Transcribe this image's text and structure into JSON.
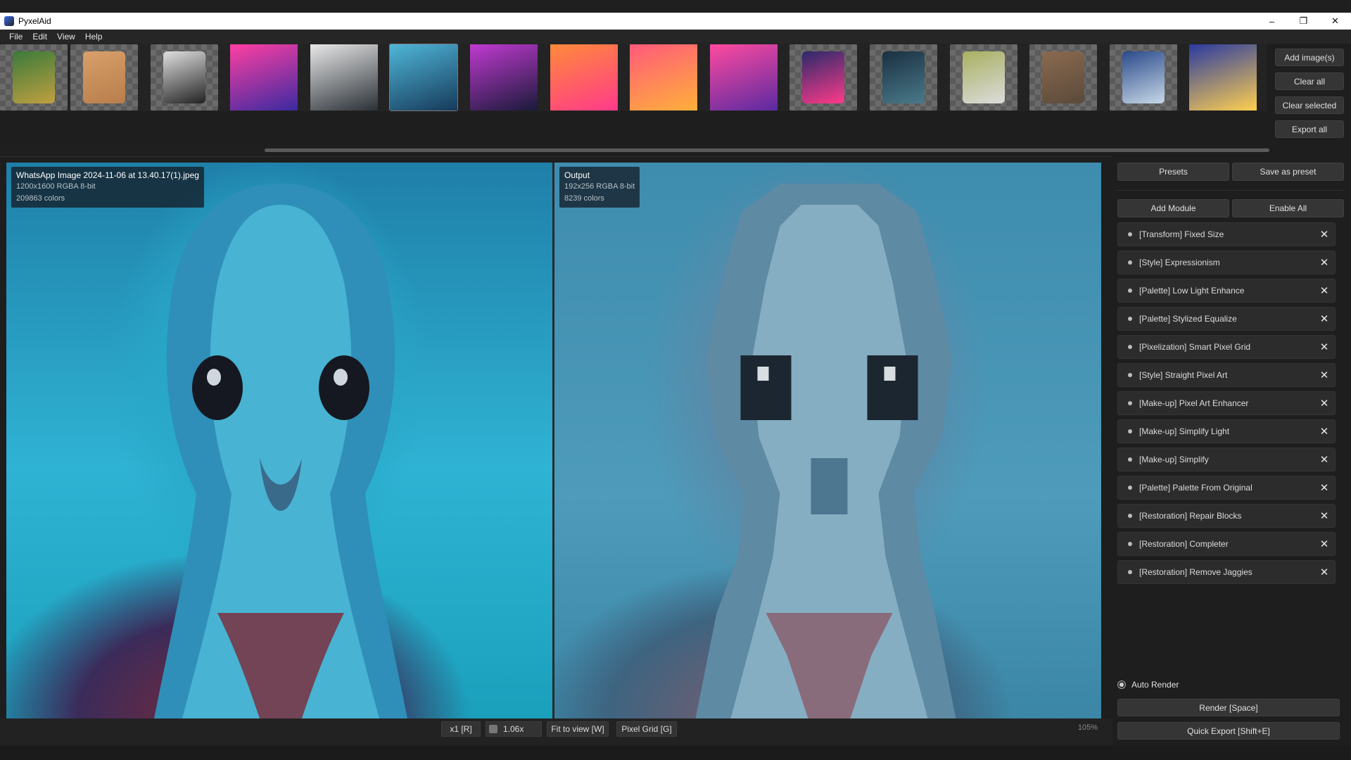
{
  "window": {
    "title": "PyxelAid",
    "minimize": "–",
    "restore": "❐",
    "close": "✕"
  },
  "menu": [
    "File",
    "Edit",
    "View",
    "Help"
  ],
  "thumbnails": [
    {
      "name": "dragon",
      "colors": [
        "#3a7a3a",
        "#c0a040"
      ]
    },
    {
      "name": "kitten",
      "colors": [
        "#d9a06a",
        "#b87d4b"
      ]
    },
    {
      "name": "figurine",
      "colors": [
        "#e0e0e0",
        "#222222"
      ]
    },
    {
      "name": "neon-woman-arcade",
      "colors": [
        "#ff3fa3",
        "#3a2aa0"
      ]
    },
    {
      "name": "scientist",
      "colors": [
        "#e8e8e8",
        "#2a3036"
      ]
    },
    {
      "name": "alien",
      "colors": [
        "#4fb6d8",
        "#163a5a"
      ]
    },
    {
      "name": "neon-woman-jacket",
      "colors": [
        "#c03ad0",
        "#1a1a3a"
      ]
    },
    {
      "name": "retro-beach-woman",
      "colors": [
        "#ff8a3a",
        "#ff3a8a"
      ]
    },
    {
      "name": "neon-street-woman",
      "colors": [
        "#ff5a7a",
        "#ffb03a"
      ]
    },
    {
      "name": "pink-hair-woman",
      "colors": [
        "#ff4aa0",
        "#5a2aa0"
      ]
    },
    {
      "name": "neon-car",
      "colors": [
        "#2a2a6a",
        "#ff3a8a"
      ]
    },
    {
      "name": "torii-landscape",
      "colors": [
        "#1a3040",
        "#4a7a8a"
      ]
    },
    {
      "name": "retro-computers",
      "colors": [
        "#a8b060",
        "#dcdcdc"
      ]
    },
    {
      "name": "zombie-figure",
      "colors": [
        "#8a6a50",
        "#5a4a3a"
      ]
    },
    {
      "name": "blue-car",
      "colors": [
        "#2a4a8a",
        "#c8d8e8"
      ]
    },
    {
      "name": "dancer-poster",
      "colors": [
        "#2a3aa0",
        "#ffd050"
      ]
    }
  ],
  "side_buttons": {
    "add_images": "Add image(s)",
    "clear_all": "Clear all",
    "clear_selected": "Clear selected",
    "export_all": "Export all"
  },
  "input_info": {
    "filename": "WhatsApp Image 2024-11-06 at 13.40.17(1).jpeg",
    "dims": "1200x1600  RGBA  8-bit",
    "colors": "209863 colors"
  },
  "output_info": {
    "title": "Output",
    "dims": "192x256  RGBA  8-bit",
    "colors": "8239 colors"
  },
  "statusbar": {
    "scale": "x1 [R]",
    "zoom_value": "1.06x",
    "fit": "Fit to view [W]",
    "pixel_grid": "Pixel Grid [G]",
    "zoom_percent": "105%"
  },
  "panel": {
    "presets": "Presets",
    "save_preset": "Save as preset",
    "add_module": "Add Module",
    "enable_all": "Enable All",
    "modules": [
      "[Transform] Fixed Size",
      "[Style] Expressionism",
      "[Palette] Low Light Enhance",
      "[Palette] Stylized Equalize",
      "[Pixelization] Smart Pixel Grid",
      "[Style] Straight Pixel Art",
      "[Make-up] Pixel Art Enhancer",
      "[Make-up] Simplify Light",
      "[Make-up] Simplify",
      "[Palette] Palette From Original",
      "[Restoration] Repair Blocks",
      "[Restoration] Completer",
      "[Restoration] Remove Jaggies"
    ],
    "close_glyph": "✕",
    "auto_render": "Auto Render",
    "render": "Render  [Space]",
    "quick_export": "Quick Export  [Shift+E]"
  }
}
